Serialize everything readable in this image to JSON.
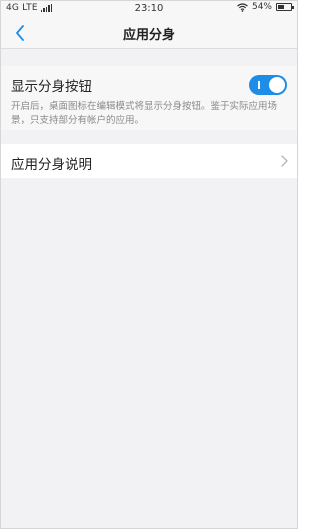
{
  "status_bar": {
    "carrier": "4G LTE",
    "time": "23:10",
    "battery_percent": "54%",
    "battery_level": 0.54,
    "icons": [
      "signal-icon",
      "wifi-icon",
      "battery-icon"
    ]
  },
  "nav": {
    "back_icon": "chevron-left-icon",
    "title": "应用分身"
  },
  "settings": {
    "toggle_row": {
      "label": "显示分身按钮",
      "enabled": true,
      "description": "开启后，桌面图标在编辑模式将显示分身按钮。鉴于实际应用场景，只支持部分有帐户的应用。"
    },
    "info_row": {
      "label": "应用分身说明",
      "icon": "chevron-right-icon"
    }
  },
  "colors": {
    "accent": "#1e8de8",
    "background": "#f2f2f4",
    "text_primary": "#222222",
    "text_secondary": "#8a8a8a"
  }
}
